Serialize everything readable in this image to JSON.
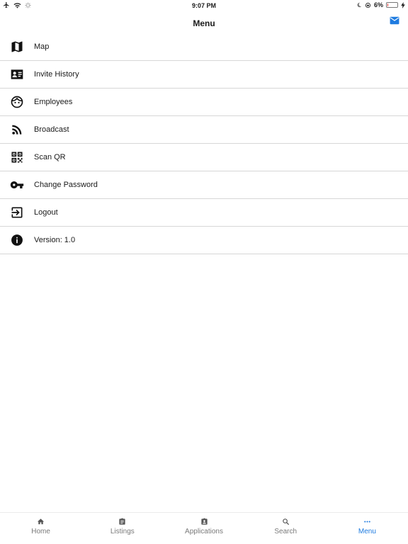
{
  "status_bar": {
    "time": "9:07 PM",
    "battery": "6%",
    "battery_level": 0.06
  },
  "header": {
    "title": "Menu"
  },
  "menu": {
    "items": [
      {
        "label": "Map",
        "icon": "map-icon"
      },
      {
        "label": "Invite History",
        "icon": "id-card-icon"
      },
      {
        "label": "Employees",
        "icon": "face-icon"
      },
      {
        "label": "Broadcast",
        "icon": "rss-icon"
      },
      {
        "label": "Scan QR",
        "icon": "qr-code-icon"
      },
      {
        "label": "Change Password",
        "icon": "key-icon"
      },
      {
        "label": "Logout",
        "icon": "logout-icon"
      },
      {
        "label": "Version: 1.0",
        "icon": "info-icon"
      }
    ]
  },
  "tabs": [
    {
      "label": "Home",
      "icon": "home-icon"
    },
    {
      "label": "Listings",
      "icon": "listings-icon"
    },
    {
      "label": "Applications",
      "icon": "applications-icon"
    },
    {
      "label": "Search",
      "icon": "search-icon"
    },
    {
      "label": "Menu",
      "icon": "more-icon",
      "active": true
    }
  ],
  "colors": {
    "accent": "#1e7be0",
    "divider": "#d7d7d7",
    "battery_low": "#e53935"
  }
}
